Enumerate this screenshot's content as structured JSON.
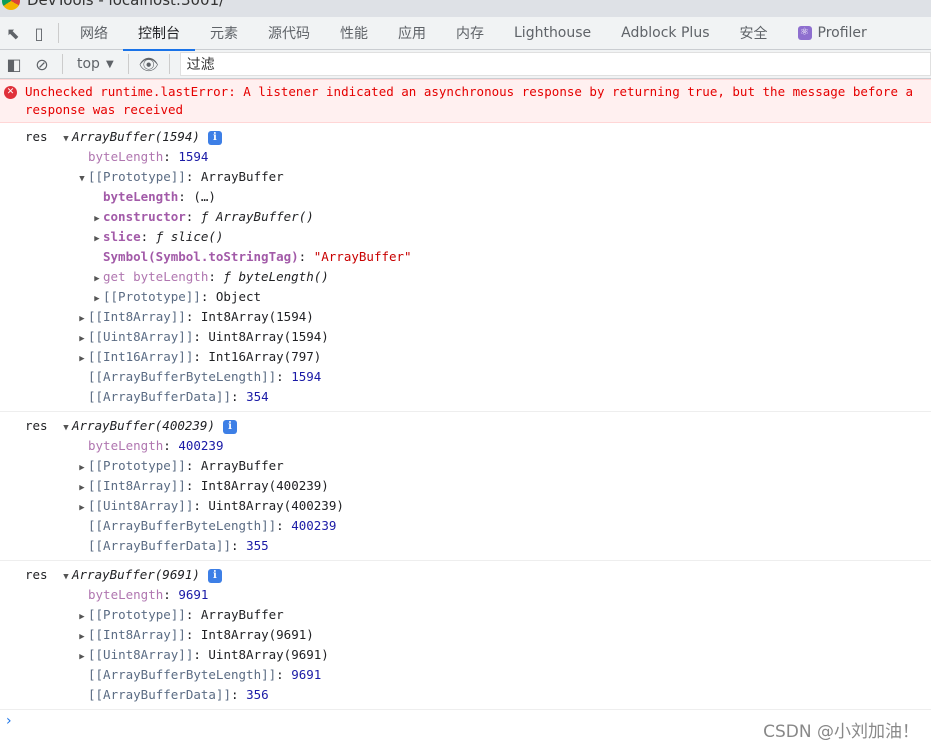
{
  "window": {
    "title": "DevTools - localhost:3001/"
  },
  "tabs": [
    {
      "label": "网络"
    },
    {
      "label": "控制台",
      "active": true
    },
    {
      "label": "元素"
    },
    {
      "label": "源代码"
    },
    {
      "label": "性能"
    },
    {
      "label": "应用"
    },
    {
      "label": "内存"
    },
    {
      "label": "Lighthouse"
    },
    {
      "label": "Adblock Plus"
    },
    {
      "label": "安全"
    },
    {
      "label": "Profiler",
      "icon": "react-atom-icon"
    }
  ],
  "toolbar": {
    "context": "top",
    "filter_value": "过滤"
  },
  "error": {
    "text": "Unchecked runtime.lastError: A listener indicated an asynchronous response by returning true, but the message before a response was received"
  },
  "colors": {
    "accent": "#1a73e8",
    "error": "#e50000",
    "error_bg": "#fff0f0",
    "number": "#1a1aa6",
    "string": "#c80000"
  },
  "entries": [
    {
      "label": "res",
      "rows": [
        {
          "d": 0,
          "a": "down",
          "p": [
            [
              "ArrayBuffer(1594)",
              "i"
            ]
          ],
          "info": true
        },
        {
          "d": 1,
          "p": [
            [
              "byteLength",
              "kp"
            ],
            [
              ": ",
              ""
            ],
            [
              "1594",
              "n"
            ]
          ]
        },
        {
          "d": 1,
          "a": "down",
          "p": [
            [
              "[[Prototype]]",
              "g"
            ],
            [
              ": ArrayBuffer",
              ""
            ]
          ]
        },
        {
          "d": 2,
          "p": [
            [
              "byteLength",
              "kb"
            ],
            [
              ":  (…)",
              ""
            ]
          ]
        },
        {
          "d": 2,
          "a": "right",
          "p": [
            [
              "constructor",
              "kb"
            ],
            [
              ": ",
              ""
            ],
            [
              "ƒ ArrayBuffer()",
              "i"
            ]
          ]
        },
        {
          "d": 2,
          "a": "right",
          "p": [
            [
              "slice",
              "kb"
            ],
            [
              ": ",
              ""
            ],
            [
              "ƒ slice()",
              "i"
            ]
          ]
        },
        {
          "d": 2,
          "p": [
            [
              "Symbol(Symbol.toStringTag)",
              "kb"
            ],
            [
              ": ",
              ""
            ],
            [
              "\"ArrayBuffer\"",
              "s"
            ]
          ]
        },
        {
          "d": 2,
          "a": "right",
          "p": [
            [
              "get byteLength",
              "kp"
            ],
            [
              ": ",
              ""
            ],
            [
              "ƒ byteLength()",
              "i"
            ]
          ]
        },
        {
          "d": 2,
          "a": "right",
          "p": [
            [
              "[[Prototype]]",
              "g"
            ],
            [
              ": Object",
              ""
            ]
          ]
        },
        {
          "d": 1,
          "a": "right",
          "p": [
            [
              "[[Int8Array]]",
              "g"
            ],
            [
              ": Int8Array(1594)",
              ""
            ]
          ]
        },
        {
          "d": 1,
          "a": "right",
          "p": [
            [
              "[[Uint8Array]]",
              "g"
            ],
            [
              ": Uint8Array(1594)",
              ""
            ]
          ]
        },
        {
          "d": 1,
          "a": "right",
          "p": [
            [
              "[[Int16Array]]",
              "g"
            ],
            [
              ": Int16Array(797)",
              ""
            ]
          ]
        },
        {
          "d": 1,
          "p": [
            [
              "[[ArrayBufferByteLength]]",
              "g"
            ],
            [
              ": ",
              ""
            ],
            [
              "1594",
              "n"
            ]
          ]
        },
        {
          "d": 1,
          "p": [
            [
              "[[ArrayBufferData]]",
              "g"
            ],
            [
              ": ",
              ""
            ],
            [
              "354",
              "n"
            ]
          ]
        }
      ]
    },
    {
      "label": "res",
      "rows": [
        {
          "d": 0,
          "a": "down",
          "p": [
            [
              "ArrayBuffer(400239)",
              "i"
            ]
          ],
          "info": true
        },
        {
          "d": 1,
          "p": [
            [
              "byteLength",
              "kp"
            ],
            [
              ": ",
              ""
            ],
            [
              "400239",
              "n"
            ]
          ]
        },
        {
          "d": 1,
          "a": "right",
          "p": [
            [
              "[[Prototype]]",
              "g"
            ],
            [
              ": ArrayBuffer",
              ""
            ]
          ]
        },
        {
          "d": 1,
          "a": "right",
          "p": [
            [
              "[[Int8Array]]",
              "g"
            ],
            [
              ": Int8Array(400239)",
              ""
            ]
          ]
        },
        {
          "d": 1,
          "a": "right",
          "p": [
            [
              "[[Uint8Array]]",
              "g"
            ],
            [
              ": Uint8Array(400239)",
              ""
            ]
          ]
        },
        {
          "d": 1,
          "p": [
            [
              "[[ArrayBufferByteLength]]",
              "g"
            ],
            [
              ": ",
              ""
            ],
            [
              "400239",
              "n"
            ]
          ]
        },
        {
          "d": 1,
          "p": [
            [
              "[[ArrayBufferData]]",
              "g"
            ],
            [
              ": ",
              ""
            ],
            [
              "355",
              "n"
            ]
          ]
        }
      ]
    },
    {
      "label": "res",
      "rows": [
        {
          "d": 0,
          "a": "down",
          "p": [
            [
              "ArrayBuffer(9691)",
              "i"
            ]
          ],
          "info": true
        },
        {
          "d": 1,
          "p": [
            [
              "byteLength",
              "kp"
            ],
            [
              ": ",
              ""
            ],
            [
              "9691",
              "n"
            ]
          ]
        },
        {
          "d": 1,
          "a": "right",
          "p": [
            [
              "[[Prototype]]",
              "g"
            ],
            [
              ": ArrayBuffer",
              ""
            ]
          ]
        },
        {
          "d": 1,
          "a": "right",
          "p": [
            [
              "[[Int8Array]]",
              "g"
            ],
            [
              ": Int8Array(9691)",
              ""
            ]
          ]
        },
        {
          "d": 1,
          "a": "right",
          "p": [
            [
              "[[Uint8Array]]",
              "g"
            ],
            [
              ": Uint8Array(9691)",
              ""
            ]
          ]
        },
        {
          "d": 1,
          "p": [
            [
              "[[ArrayBufferByteLength]]",
              "g"
            ],
            [
              ": ",
              ""
            ],
            [
              "9691",
              "n"
            ]
          ]
        },
        {
          "d": 1,
          "p": [
            [
              "[[ArrayBufferData]]",
              "g"
            ],
            [
              ": ",
              ""
            ],
            [
              "356",
              "n"
            ]
          ]
        }
      ]
    }
  ],
  "prompt": "›",
  "watermark": "CSDN @小刘加油！"
}
